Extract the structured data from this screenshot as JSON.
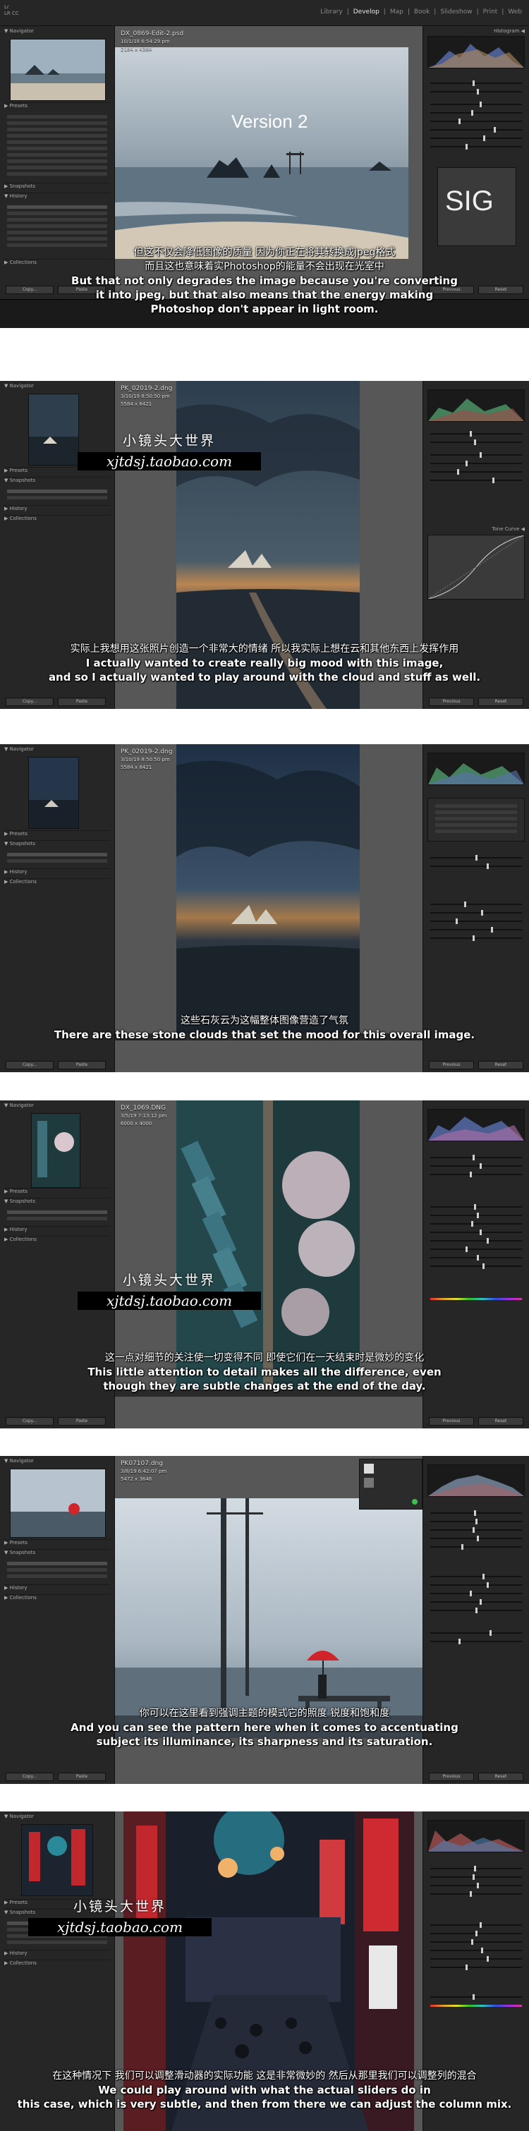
{
  "modules": [
    "Library",
    "Develop",
    "Map",
    "Book",
    "Slideshow",
    "Print",
    "Web"
  ],
  "active_module": "Develop",
  "frames": [
    {
      "file": "DX_0869-Edit-2.psd",
      "meta": [
        "10/1/18 6:54:29 pm",
        "2184 x 4384"
      ],
      "overlay_text": "Version 2",
      "zh": [
        "但这不仅会降低图像的质量 因为你正在将其转换成jpeg格式",
        "而且这也意味着实Photoshop的能量不会出现在光室中"
      ],
      "en": [
        "But that not only degrades the image because you're converting",
        "it into jpeg, but that also means that the energy making",
        "Photoshop don't appear in light room."
      ]
    },
    {
      "file": "PK_02019-2.dng",
      "meta": [
        "3/10/19 8:50:50 pm",
        "5584 x 8421"
      ],
      "zh": [
        "实际上我想用这张照片创造一个非常大的情绪 所以我实际上想在云和其他东西上发挥作用"
      ],
      "en": [
        "I actually wanted to create really big mood with this image,",
        "and so I actually wanted to play around with the cloud and stuff as well."
      ]
    },
    {
      "file": "PK_02019-2.dng",
      "meta": [
        "3/10/19 8:50:50 pm",
        "5584 x 8421"
      ],
      "zh": [
        "这些石灰云为这幅整体图像营造了气氛"
      ],
      "en": [
        "There are these stone clouds that set the mood for this overall image."
      ]
    },
    {
      "file": "DX_1069.DNG",
      "meta": [
        "3/5/19 7:13:12 pm",
        "6000 x 4000"
      ],
      "zh": [
        "这一点对细节的关注使一切变得不同 即使它们在一天结束时是微妙的变化"
      ],
      "en": [
        "This little attention to detail makes all the difference, even",
        "though they are subtle changes at the end of the day."
      ]
    },
    {
      "file": "PK07107.dng",
      "meta": [
        "3/8/19 6:42:07 pm",
        "5472 x 3648"
      ],
      "zh": [
        "你可以在这里看到强调主题的模式它的照度 锐度和饱和度"
      ],
      "en": [
        "And you can see the pattern here when it comes to accentuating",
        "subject its illuminance, its sharpness and its saturation."
      ]
    },
    {
      "file": "",
      "meta": [],
      "zh": [
        "在这种情况下 我们可以调整滑动器的实际功能 这是非常微妙的 然后从那里我们可以调整列的混合"
      ],
      "en": [
        "We could play around with what the actual sliders do in",
        "this case, which is very subtle, and then from there we can adjust the column mix."
      ]
    }
  ],
  "watermark": {
    "cn": "小镜头大世界",
    "url": "xjtdsj.taobao.com"
  }
}
